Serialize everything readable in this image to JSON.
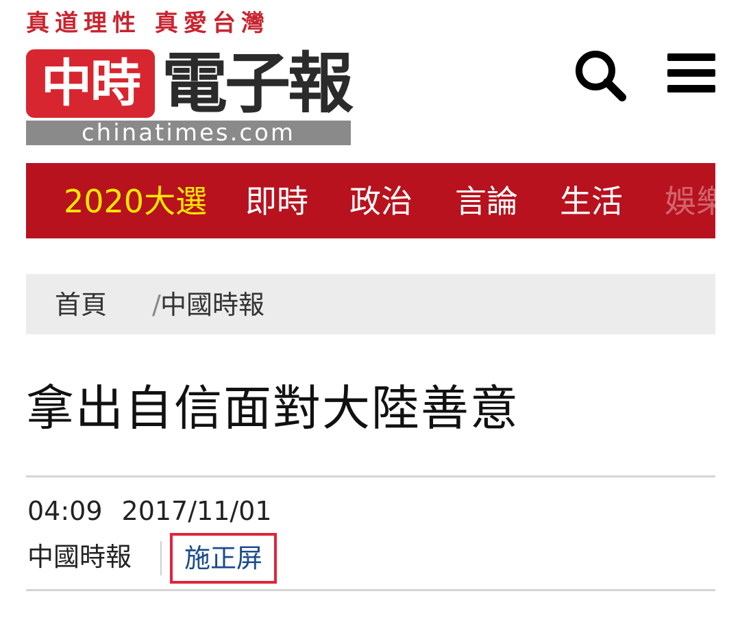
{
  "header": {
    "slogan": "真道理性 真愛台灣",
    "logo_badge": "中時",
    "logo_word": "電子報",
    "logo_domain": "chinatimes.com",
    "search_icon": "search-icon",
    "menu_icon": "hamburger-menu-icon"
  },
  "nav": {
    "items": [
      {
        "label": "2020大選"
      },
      {
        "label": "即時"
      },
      {
        "label": "政治"
      },
      {
        "label": "言論"
      },
      {
        "label": "生活"
      },
      {
        "label": "娛樂"
      }
    ]
  },
  "breadcrumb": {
    "home": "首頁",
    "separator": "/",
    "section": "中國時報"
  },
  "article": {
    "title": "拿出自信面對大陸善意",
    "time": "04:09",
    "date": "2017/11/01",
    "source": "中國時報",
    "author": "施正屏"
  },
  "colors": {
    "brand_red": "#b8121e",
    "highlight_yellow": "#ffea00",
    "author_link": "#1a4c8c",
    "annotation_box": "#e0243a"
  }
}
